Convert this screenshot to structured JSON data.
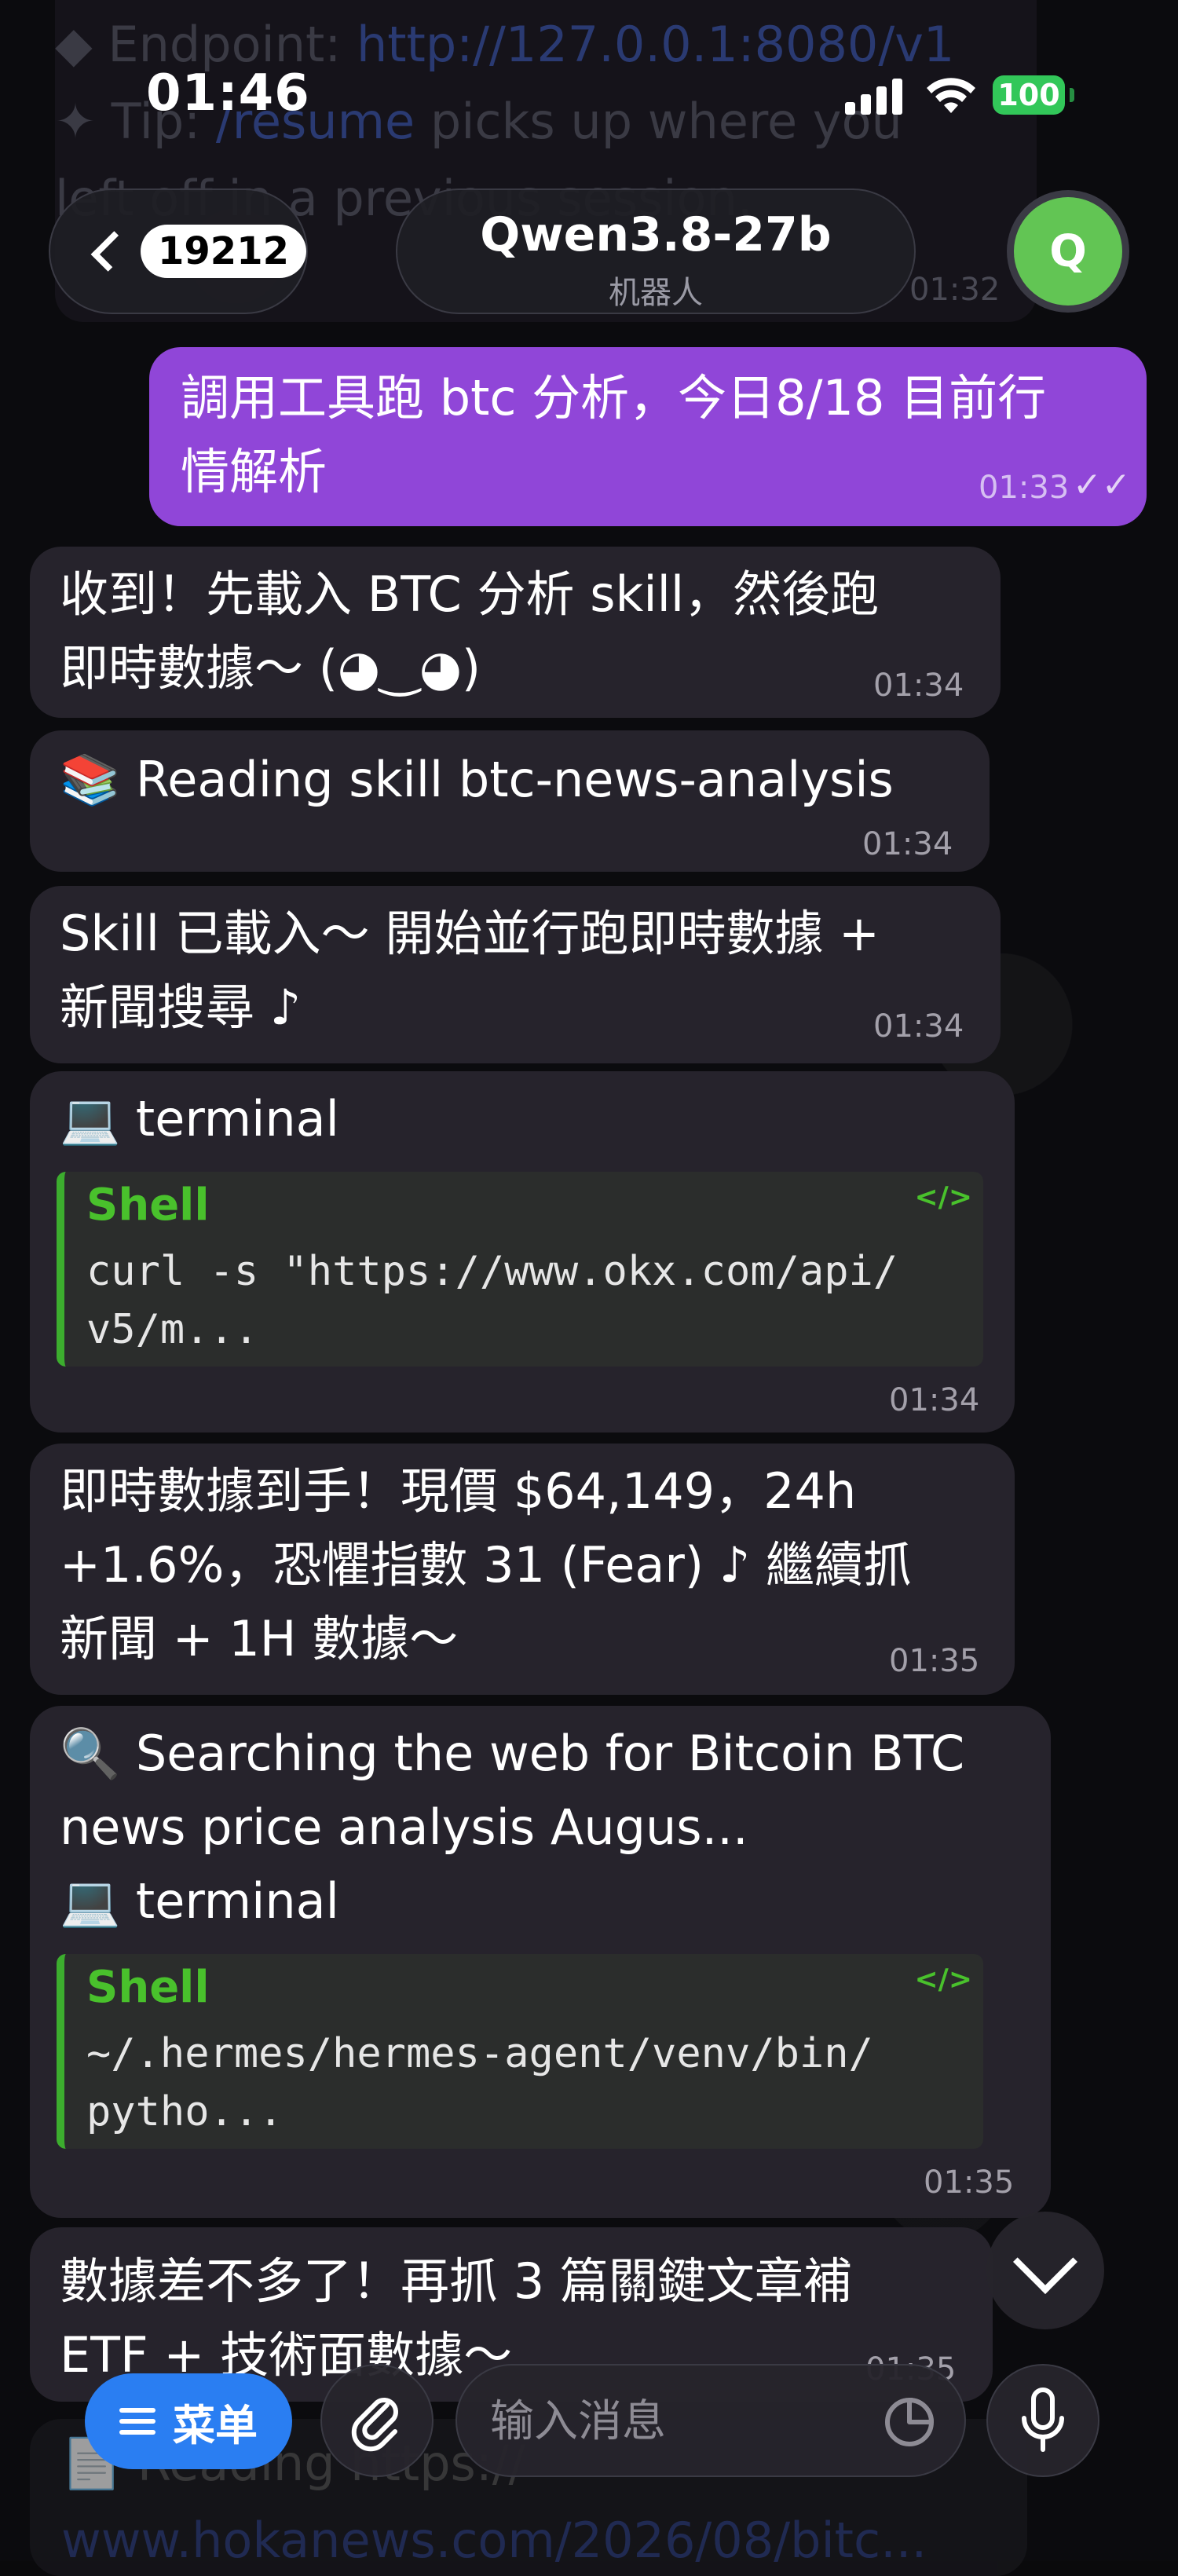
{
  "status_bar": {
    "time": "01:46",
    "battery": "100"
  },
  "background_message": {
    "line1_prefix": "◆ Endpoint: ",
    "line1_link": "http://127.0.0.1:8080/v1",
    "line2_prefix": "✦ Tip: ",
    "line2_link": "/resume",
    "line2_suffix": " picks up where you",
    "line3": "left off in a previous session.",
    "time": "01:32"
  },
  "header": {
    "back_count": "19212",
    "chat_title": "Qwen3.8-27b",
    "chat_subtitle": "机器人",
    "avatar_letter": "Q"
  },
  "messages": [
    {
      "dir": "out",
      "lines": [
        "調用工具跑 btc 分析，今日8/18 目前行",
        "情解析"
      ],
      "time": "01:33",
      "read": "✓✓"
    },
    {
      "dir": "in",
      "lines": [
        "收到！先載入 BTC 分析 skill，然後跑",
        "即時數據～ (◕‿◕)"
      ],
      "time": "01:34"
    },
    {
      "dir": "in",
      "lines": [
        "📚 Reading skill btc-news-analysis"
      ],
      "time": "01:34"
    },
    {
      "dir": "in",
      "lines": [
        "Skill 已載入～ 開始並行跑即時數據 +",
        "新聞搜尋 ♪"
      ],
      "time": "01:34"
    },
    {
      "dir": "in",
      "lines": [
        "💻 terminal"
      ],
      "code": {
        "lang": "Shell",
        "tag": "</>",
        "text": "curl -s \"https://www.okx.com/api/\nv5/m..."
      },
      "time": "01:34"
    },
    {
      "dir": "in",
      "lines": [
        "即時數據到手！現價 $64,149，24h",
        "+1.6%，恐懼指數 31 (Fear) ♪ 繼續抓",
        "新聞 + 1H 數據～"
      ],
      "time": "01:35"
    },
    {
      "dir": "in",
      "lines": [
        "🔍 Searching the web for Bitcoin BTC",
        "news price analysis Augus...",
        "💻 terminal"
      ],
      "code": {
        "lang": "Shell",
        "tag": "</>",
        "text": "~/.hermes/hermes-agent/venv/bin/\npytho..."
      },
      "time": "01:35"
    },
    {
      "dir": "in",
      "lines": [
        "數據差不多了！再抓 3 篇關鍵文章補",
        "ETF + 技術面數據～"
      ],
      "time": "01:35"
    }
  ],
  "hidden_message": {
    "line1": "📄 Reading https://",
    "line2": "www.hokanews.com/2026/08/bitc..."
  },
  "input_bar": {
    "menu_label": "菜单",
    "placeholder": "输入消息"
  },
  "colors": {
    "outgoing": "#9046d8",
    "incoming": "#26232c",
    "accent": "#2a7ef2",
    "code_green": "#49c12c"
  }
}
